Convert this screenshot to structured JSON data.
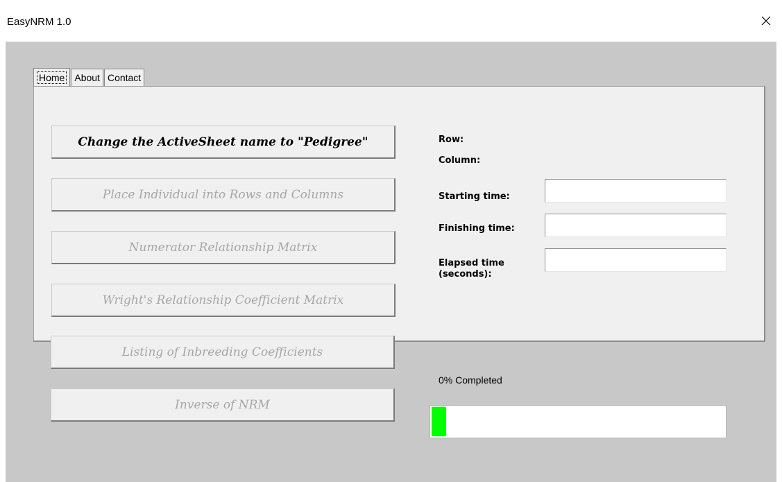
{
  "window": {
    "title": "EasyNRM 1.0",
    "close_glyph": "✕"
  },
  "tabs": [
    {
      "label": "Home",
      "active": true
    },
    {
      "label": "About",
      "active": false
    },
    {
      "label": "Contact",
      "active": false
    }
  ],
  "buttons": [
    {
      "label": "Change the ActiveSheet name to \"Pedigree\"",
      "enabled": true
    },
    {
      "label": "Place Individual into Rows and Columns",
      "enabled": false
    },
    {
      "label": "Numerator Relationship Matrix",
      "enabled": false
    },
    {
      "label": "Wright's Relationship Coefficient Matrix",
      "enabled": false
    },
    {
      "label": "Listing of Inbreeding Coefficients",
      "enabled": false
    },
    {
      "label": "Inverse of NRM",
      "enabled": false
    }
  ],
  "info": {
    "row_label": "Row:",
    "column_label": "Column:",
    "starting_time_label": "Starting time:",
    "starting_time_value": "",
    "finishing_time_label": "Finishing time:",
    "finishing_time_value": "",
    "elapsed_time_label_line1": "Elapsed time",
    "elapsed_time_label_line2": "(seconds):",
    "elapsed_time_value": ""
  },
  "progress": {
    "status_text": "0% Completed",
    "fraction": 0.05,
    "color": "#00ff00"
  },
  "colors": {
    "client_background": "#c8c8c8",
    "panel_background": "#f0f0f0",
    "disabled_text": "#a6a6a6"
  }
}
